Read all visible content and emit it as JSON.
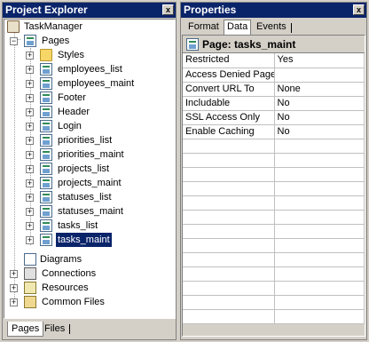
{
  "left_panel": {
    "title": "Project Explorer",
    "close": "x"
  },
  "right_panel": {
    "title": "Properties",
    "close": "x"
  },
  "tree": {
    "root": "TaskManager",
    "pages_folder": "Pages",
    "styles": "Styles",
    "pages": [
      "employees_list",
      "employees_maint",
      "Footer",
      "Header",
      "Login",
      "priorities_list",
      "priorities_maint",
      "projects_list",
      "projects_maint",
      "statuses_list",
      "statuses_maint",
      "tasks_list",
      "tasks_maint"
    ],
    "diagrams": "Diagrams",
    "connections": "Connections",
    "resources": "Resources",
    "common_files": "Common Files"
  },
  "left_tabs": [
    "Pages",
    "Files"
  ],
  "right_tabs": [
    "Format",
    "Data",
    "Events"
  ],
  "props_header": "Page: tasks_maint",
  "properties": [
    {
      "name": "Restricted",
      "value": "Yes"
    },
    {
      "name": "Access Denied Page",
      "value": ""
    },
    {
      "name": "Convert URL To",
      "value": "None"
    },
    {
      "name": "Includable",
      "value": "No"
    },
    {
      "name": "SSL Access Only",
      "value": "No"
    },
    {
      "name": "Enable Caching",
      "value": "No"
    }
  ],
  "empty_rows": 13,
  "colors": {
    "titlebar": "#0a246a",
    "face": "#d4d0c8",
    "selection": "#0a246a"
  }
}
